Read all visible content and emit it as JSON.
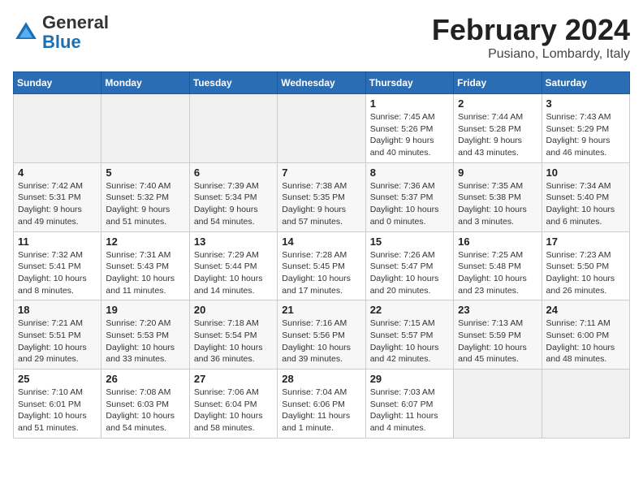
{
  "header": {
    "logo_general": "General",
    "logo_blue": "Blue",
    "main_title": "February 2024",
    "sub_title": "Pusiano, Lombardy, Italy"
  },
  "days_of_week": [
    "Sunday",
    "Monday",
    "Tuesday",
    "Wednesday",
    "Thursday",
    "Friday",
    "Saturday"
  ],
  "weeks": [
    [
      {
        "day": "",
        "info": ""
      },
      {
        "day": "",
        "info": ""
      },
      {
        "day": "",
        "info": ""
      },
      {
        "day": "",
        "info": ""
      },
      {
        "day": "1",
        "info": "Sunrise: 7:45 AM\nSunset: 5:26 PM\nDaylight: 9 hours\nand 40 minutes."
      },
      {
        "day": "2",
        "info": "Sunrise: 7:44 AM\nSunset: 5:28 PM\nDaylight: 9 hours\nand 43 minutes."
      },
      {
        "day": "3",
        "info": "Sunrise: 7:43 AM\nSunset: 5:29 PM\nDaylight: 9 hours\nand 46 minutes."
      }
    ],
    [
      {
        "day": "4",
        "info": "Sunrise: 7:42 AM\nSunset: 5:31 PM\nDaylight: 9 hours\nand 49 minutes."
      },
      {
        "day": "5",
        "info": "Sunrise: 7:40 AM\nSunset: 5:32 PM\nDaylight: 9 hours\nand 51 minutes."
      },
      {
        "day": "6",
        "info": "Sunrise: 7:39 AM\nSunset: 5:34 PM\nDaylight: 9 hours\nand 54 minutes."
      },
      {
        "day": "7",
        "info": "Sunrise: 7:38 AM\nSunset: 5:35 PM\nDaylight: 9 hours\nand 57 minutes."
      },
      {
        "day": "8",
        "info": "Sunrise: 7:36 AM\nSunset: 5:37 PM\nDaylight: 10 hours\nand 0 minutes."
      },
      {
        "day": "9",
        "info": "Sunrise: 7:35 AM\nSunset: 5:38 PM\nDaylight: 10 hours\nand 3 minutes."
      },
      {
        "day": "10",
        "info": "Sunrise: 7:34 AM\nSunset: 5:40 PM\nDaylight: 10 hours\nand 6 minutes."
      }
    ],
    [
      {
        "day": "11",
        "info": "Sunrise: 7:32 AM\nSunset: 5:41 PM\nDaylight: 10 hours\nand 8 minutes."
      },
      {
        "day": "12",
        "info": "Sunrise: 7:31 AM\nSunset: 5:43 PM\nDaylight: 10 hours\nand 11 minutes."
      },
      {
        "day": "13",
        "info": "Sunrise: 7:29 AM\nSunset: 5:44 PM\nDaylight: 10 hours\nand 14 minutes."
      },
      {
        "day": "14",
        "info": "Sunrise: 7:28 AM\nSunset: 5:45 PM\nDaylight: 10 hours\nand 17 minutes."
      },
      {
        "day": "15",
        "info": "Sunrise: 7:26 AM\nSunset: 5:47 PM\nDaylight: 10 hours\nand 20 minutes."
      },
      {
        "day": "16",
        "info": "Sunrise: 7:25 AM\nSunset: 5:48 PM\nDaylight: 10 hours\nand 23 minutes."
      },
      {
        "day": "17",
        "info": "Sunrise: 7:23 AM\nSunset: 5:50 PM\nDaylight: 10 hours\nand 26 minutes."
      }
    ],
    [
      {
        "day": "18",
        "info": "Sunrise: 7:21 AM\nSunset: 5:51 PM\nDaylight: 10 hours\nand 29 minutes."
      },
      {
        "day": "19",
        "info": "Sunrise: 7:20 AM\nSunset: 5:53 PM\nDaylight: 10 hours\nand 33 minutes."
      },
      {
        "day": "20",
        "info": "Sunrise: 7:18 AM\nSunset: 5:54 PM\nDaylight: 10 hours\nand 36 minutes."
      },
      {
        "day": "21",
        "info": "Sunrise: 7:16 AM\nSunset: 5:56 PM\nDaylight: 10 hours\nand 39 minutes."
      },
      {
        "day": "22",
        "info": "Sunrise: 7:15 AM\nSunset: 5:57 PM\nDaylight: 10 hours\nand 42 minutes."
      },
      {
        "day": "23",
        "info": "Sunrise: 7:13 AM\nSunset: 5:59 PM\nDaylight: 10 hours\nand 45 minutes."
      },
      {
        "day": "24",
        "info": "Sunrise: 7:11 AM\nSunset: 6:00 PM\nDaylight: 10 hours\nand 48 minutes."
      }
    ],
    [
      {
        "day": "25",
        "info": "Sunrise: 7:10 AM\nSunset: 6:01 PM\nDaylight: 10 hours\nand 51 minutes."
      },
      {
        "day": "26",
        "info": "Sunrise: 7:08 AM\nSunset: 6:03 PM\nDaylight: 10 hours\nand 54 minutes."
      },
      {
        "day": "27",
        "info": "Sunrise: 7:06 AM\nSunset: 6:04 PM\nDaylight: 10 hours\nand 58 minutes."
      },
      {
        "day": "28",
        "info": "Sunrise: 7:04 AM\nSunset: 6:06 PM\nDaylight: 11 hours\nand 1 minute."
      },
      {
        "day": "29",
        "info": "Sunrise: 7:03 AM\nSunset: 6:07 PM\nDaylight: 11 hours\nand 4 minutes."
      },
      {
        "day": "",
        "info": ""
      },
      {
        "day": "",
        "info": ""
      }
    ]
  ]
}
